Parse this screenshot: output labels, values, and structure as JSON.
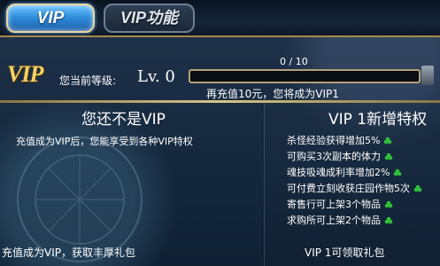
{
  "tabs": [
    {
      "label": "VIP",
      "active": true
    },
    {
      "label": "VIP功能",
      "active": false
    }
  ],
  "header": {
    "logo": "VIP",
    "level_label": "您当前等级:",
    "level_value": "Lv. 0",
    "progress": {
      "text": "0 / 10",
      "current": 0,
      "max": 10,
      "fraction": 0
    },
    "recharge_hint": "再充值10元，您将成为VIP1"
  },
  "left_panel": {
    "title": "您还不是VIP",
    "description": "充值成为VIP后，您能享受到各种VIP特权",
    "bottom": "充值成为VIP，获取丰厚礼包"
  },
  "right_panel": {
    "title": "VIP 1新增特权",
    "perks": [
      "杀怪经验获得增加5%",
      "可购买3次副本的体力",
      "魂技吸魂成利率增加2%",
      "可付费立刻收获庄园作物5次",
      "寄售行可上架3个物品",
      "求购所可上架2个物品"
    ],
    "perk_icon": "green-clover-icon",
    "bottom": "VIP 1可领取礼包"
  },
  "colors": {
    "gold": "#f6d26a",
    "active_tab": "#2b8ad8",
    "clover": "#2fbf3a"
  }
}
